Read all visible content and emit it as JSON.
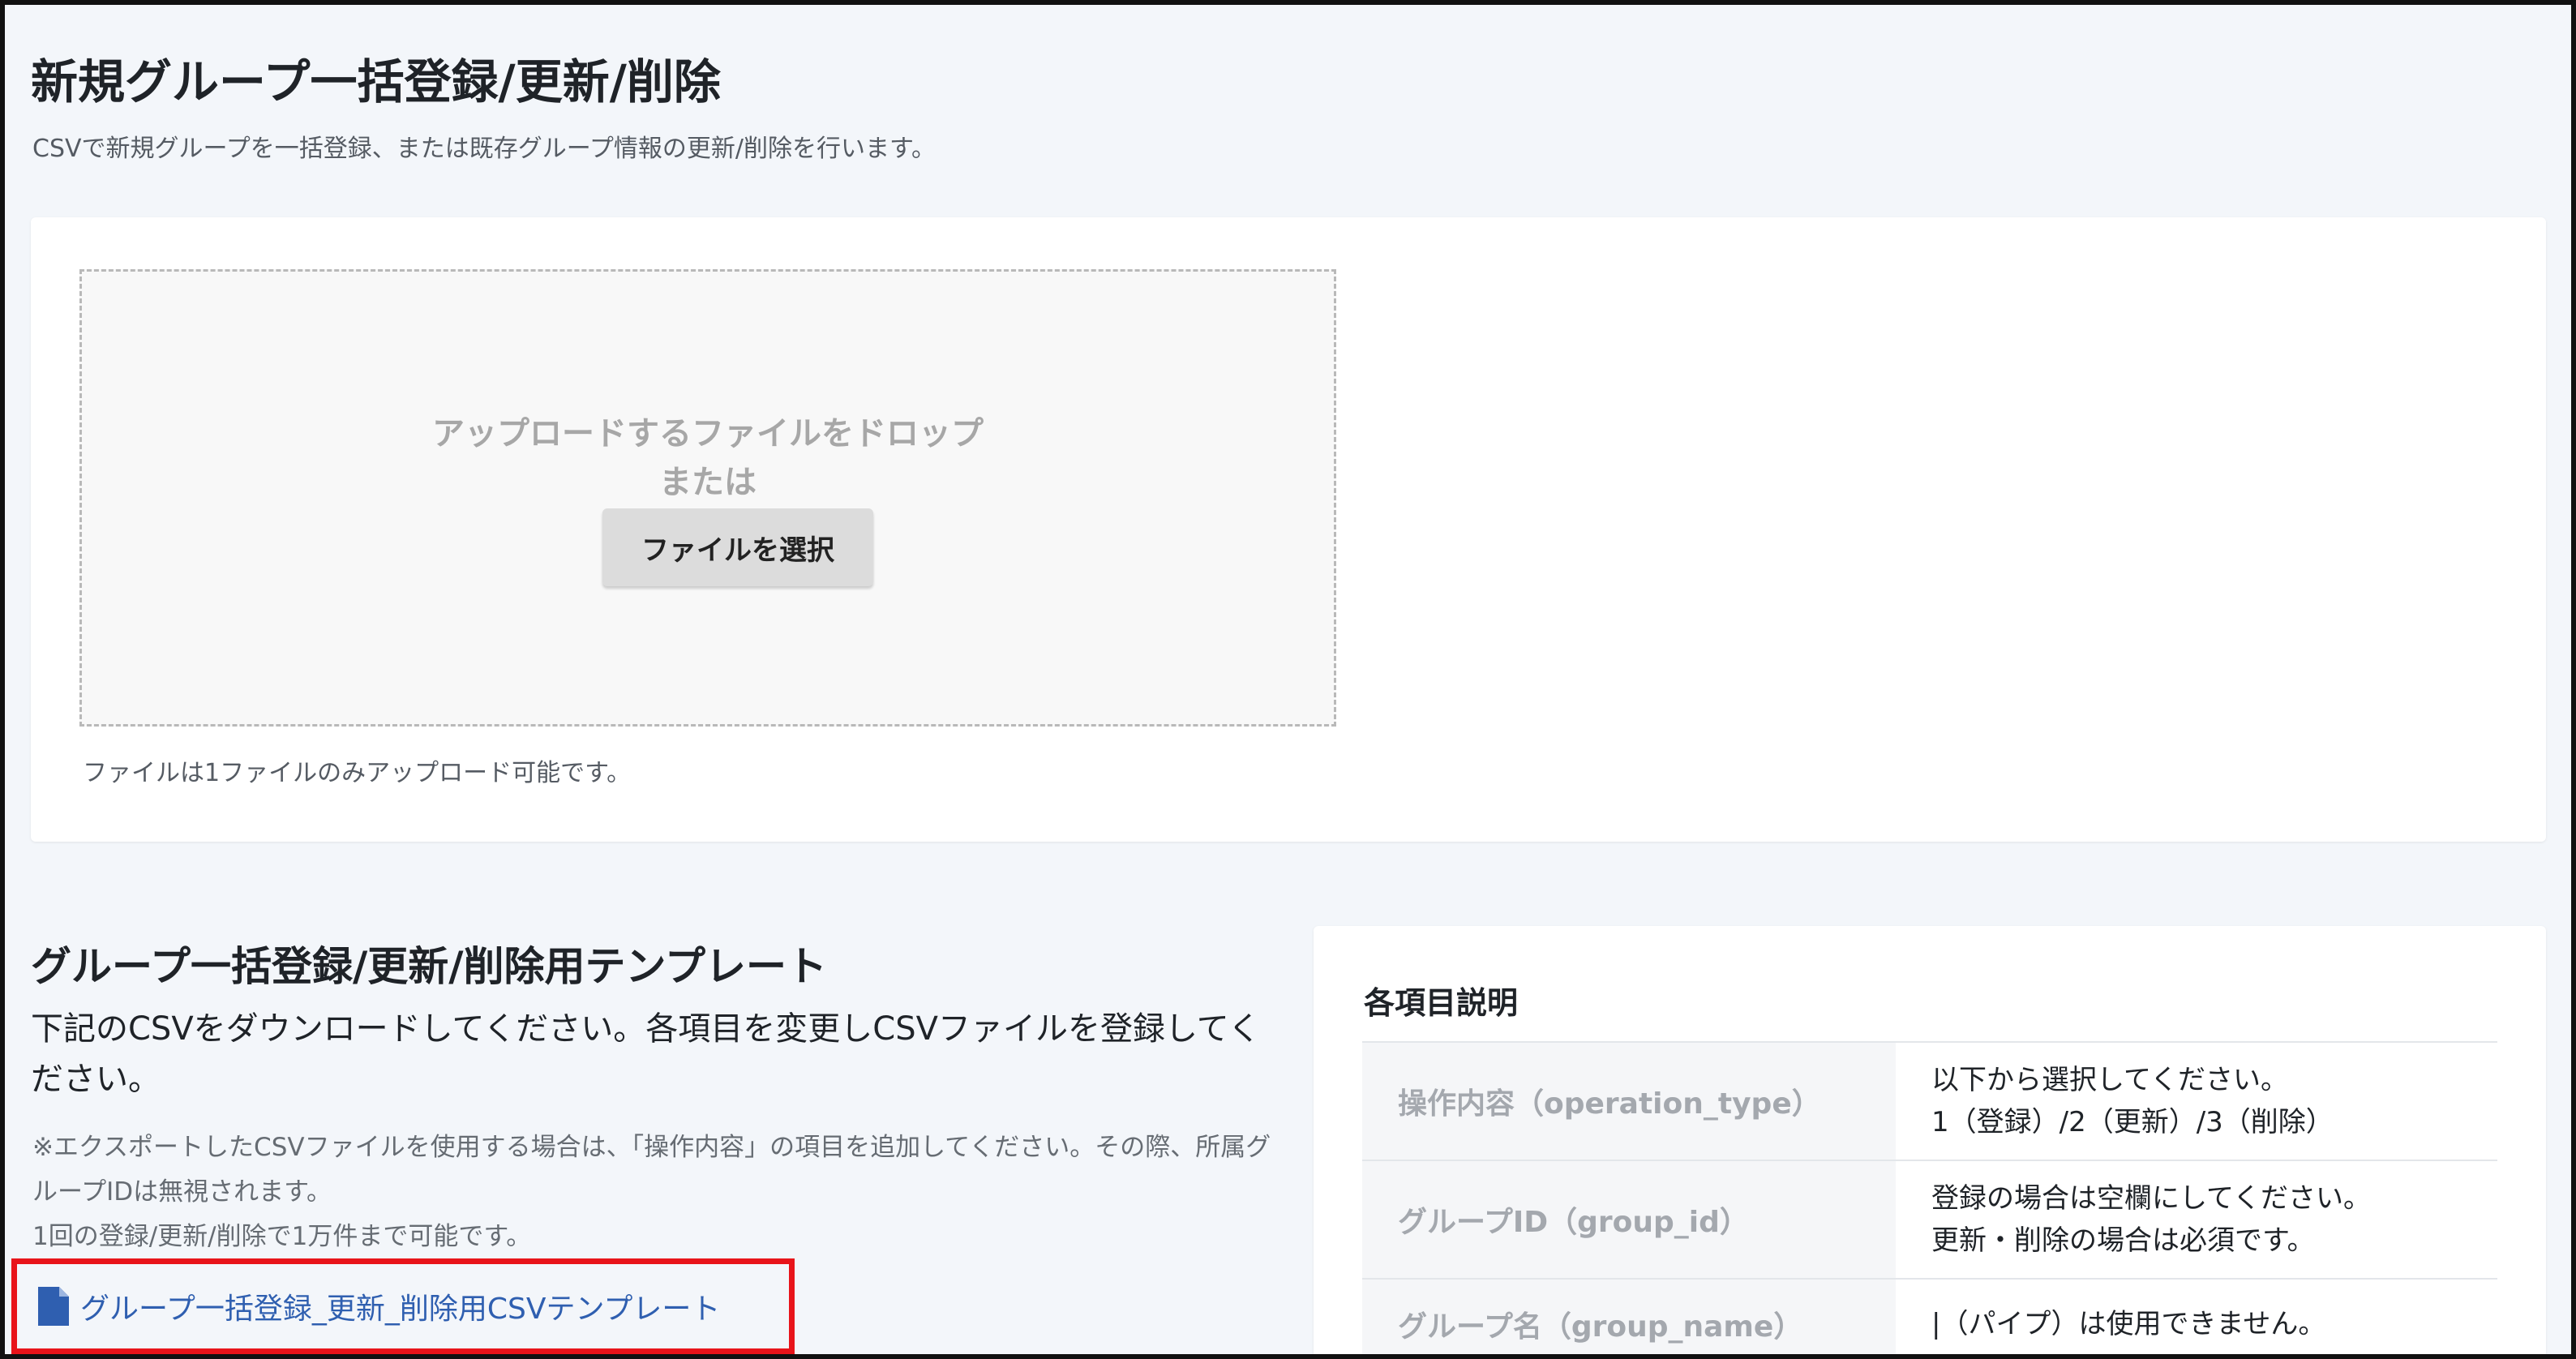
{
  "page": {
    "title": "新規グループ一括登録/更新/削除",
    "description": "CSVで新規グループを一括登録、または既存グループ情報の更新/削除を行います。"
  },
  "upload": {
    "drop_text": "アップロードするファイルをドロップ",
    "or_text": "または",
    "select_button": "ファイルを選択",
    "note": "ファイルは1ファイルのみアップロード可能です。"
  },
  "template": {
    "title": "グループ一括登録/更新/削除用テンプレート",
    "description": "下記のCSVをダウンロードしてください。各項目を変更しCSVファイルを登録してください。",
    "note_1": "※エクスポートしたCSVファイルを使用する場合は、「操作内容」の項目を追加してください。その際、所属グループIDは無視されます。",
    "note_2": "1回の登録/更新/削除で1万件まで可能です。",
    "link_label": "グループ一括登録_更新_削除用CSVテンプレート",
    "link_icon": "document-icon",
    "highlight_color": "#e8141a",
    "link_color": "#2f5fb0"
  },
  "item_description": {
    "title": "各項目説明",
    "rows": [
      {
        "key": "操作内容（operation_type）",
        "value_lines": [
          "以下から選択してください。",
          "1（登録）/2（更新）/3（削除）"
        ]
      },
      {
        "key": "グループID（group_id）",
        "value_lines": [
          "登録の場合は空欄にしてください。",
          "更新・削除の場合は必須です。"
        ]
      },
      {
        "key": "グループ名（group_name）",
        "value_lines": [
          "|（パイプ）は使用できません。"
        ]
      }
    ]
  }
}
